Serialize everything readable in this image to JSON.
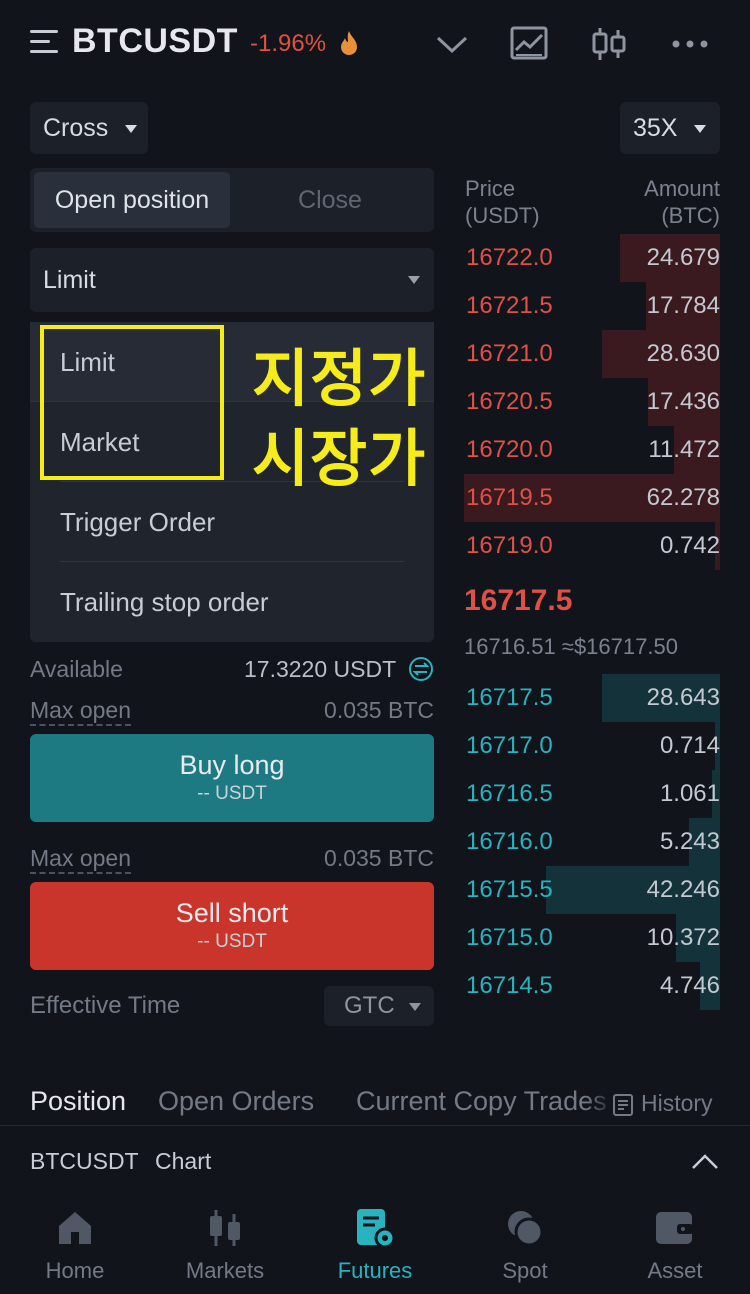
{
  "header": {
    "symbol": "BTCUSDT",
    "change": "-1.96%",
    "fire_icon": "fire-icon",
    "icons": [
      "chevron-down-icon",
      "chart-icon",
      "candlestick-icon",
      "more-icon"
    ]
  },
  "margin_mode": "Cross",
  "leverage": "35X",
  "tabs": {
    "open": "Open position",
    "close": "Close"
  },
  "order_type": {
    "selected": "Limit",
    "options": [
      "Limit",
      "Market",
      "Trigger Order",
      "Trailing stop order"
    ]
  },
  "annotation": {
    "line1": "지정가",
    "line2": "시장가"
  },
  "available": {
    "label": "Available",
    "value": "17.3220 USDT"
  },
  "max_open_long": {
    "label": "Max open",
    "value": "0.035 BTC"
  },
  "buy": {
    "label": "Buy long",
    "sub": "-- USDT"
  },
  "max_open_short": {
    "label": "Max open",
    "value": "0.035 BTC"
  },
  "sell": {
    "label": "Sell short",
    "sub": "-- USDT"
  },
  "effective_time": {
    "label": "Effective Time",
    "value": "GTC"
  },
  "orderbook": {
    "price_header": [
      "Price",
      "(USDT)"
    ],
    "amount_header": [
      "Amount",
      "(BTC)"
    ],
    "asks": [
      {
        "price": "16722.0",
        "amount": "24.679",
        "depth": 0.39
      },
      {
        "price": "16721.5",
        "amount": "17.784",
        "depth": 0.29
      },
      {
        "price": "16721.0",
        "amount": "28.630",
        "depth": 0.46
      },
      {
        "price": "16720.5",
        "amount": "17.436",
        "depth": 0.28
      },
      {
        "price": "16720.0",
        "amount": "11.472",
        "depth": 0.18
      },
      {
        "price": "16719.5",
        "amount": "62.278",
        "depth": 1.0
      },
      {
        "price": "16719.0",
        "amount": "0.742",
        "depth": 0.02
      }
    ],
    "last_price": "16717.5",
    "mark_price": "16716.51 ≈$16717.50",
    "bids": [
      {
        "price": "16717.5",
        "amount": "28.643",
        "depth": 0.46
      },
      {
        "price": "16717.0",
        "amount": "0.714",
        "depth": 0.02
      },
      {
        "price": "16716.5",
        "amount": "1.061",
        "depth": 0.03
      },
      {
        "price": "16716.0",
        "amount": "5.243",
        "depth": 0.12
      },
      {
        "price": "16715.5",
        "amount": "42.246",
        "depth": 0.68
      },
      {
        "price": "16715.0",
        "amount": "10.372",
        "depth": 0.17
      },
      {
        "price": "16714.5",
        "amount": "4.746",
        "depth": 0.08
      }
    ]
  },
  "bottom_tabs": [
    "Position",
    "Open Orders",
    "Current Copy Trades"
  ],
  "history": "History",
  "chart_bar": {
    "symbol": "BTCUSDT",
    "chart": "Chart"
  },
  "nav": [
    {
      "label": "Home",
      "icon": "home-icon"
    },
    {
      "label": "Markets",
      "icon": "markets-icon"
    },
    {
      "label": "Futures",
      "icon": "futures-icon"
    },
    {
      "label": "Spot",
      "icon": "spot-icon"
    },
    {
      "label": "Asset",
      "icon": "wallet-icon"
    }
  ],
  "colors": {
    "ask": "#e05045",
    "bid": "#28b3bf",
    "buy": "#1e7a82",
    "sell": "#c9352b",
    "highlight": "#f5ec1a"
  }
}
